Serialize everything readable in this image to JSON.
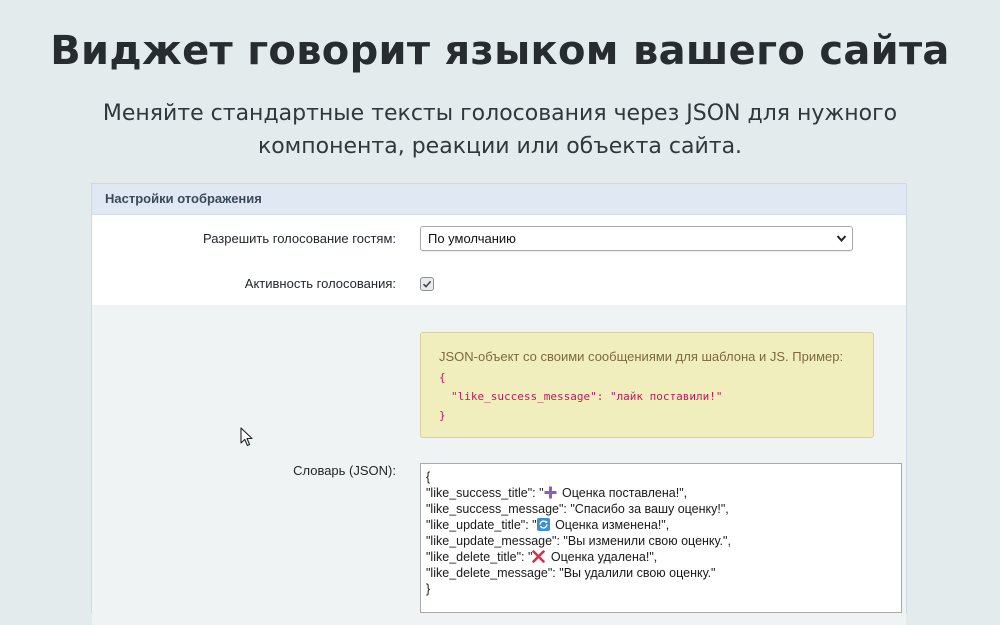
{
  "hero": {
    "title": "Виджет говорит языком вашего сайта",
    "subtitle_line1": "Меняйте стандартные тексты голосования через JSON для нужного",
    "subtitle_line2": "компонента, реакции или объекта сайта."
  },
  "panel": {
    "header": "Настройки отображения",
    "guest_vote": {
      "label": "Разрешить голосование гостям:",
      "selected": "По умолчанию"
    },
    "activity": {
      "label": "Активность голосования:",
      "checked": true
    },
    "note": {
      "text": "JSON-объект со своими сообщениями для шаблона и JS. Пример:",
      "code_open": "{",
      "code_line": "\"like_success_message\": \"лайк поставили!\"",
      "code_close": "}"
    },
    "dictionary": {
      "label": "Словарь (JSON):",
      "lines": [
        "{",
        "\"like_success_title\": \"",
        " Оценка поставлена!\",",
        "\"like_success_message\": \"Спасибо за вашу оценку!\",",
        "\"like_update_title\": \"",
        " Оценка изменена!\",",
        "\"like_update_message\": \"Вы изменили свою оценку.\",",
        "\"like_delete_title\": \"",
        " Оценка удалена!\",",
        "\"like_delete_message\": \"Вы удалили свою оценку.\"",
        " }"
      ],
      "icons": [
        "plus-icon",
        "refresh-icon",
        "cross-icon"
      ]
    }
  },
  "colors": {
    "page_bg": "#e4ebec",
    "panel_header_bg": "#e0e9f3",
    "note_bg": "#f1eebe",
    "code_color": "#c2185b"
  }
}
